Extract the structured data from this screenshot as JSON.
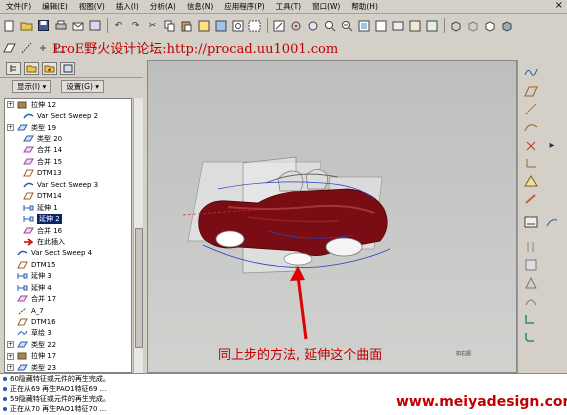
{
  "menu": {
    "items": [
      "文件(F)",
      "编辑(E)",
      "视图(V)",
      "插入(I)",
      "分析(A)",
      "信息(N)",
      "应用程序(P)",
      "工具(T)",
      "窗口(W)",
      "帮助(H)"
    ],
    "close_glyph": "×"
  },
  "watermark_top": "ProE野火设计论坛:http://procad.uu1001.com",
  "watermark_bottom": "www.meiyadesign.com",
  "panel": {
    "display_button": "显示(I) ▾",
    "settings_button": "设置(G) ▾"
  },
  "tree": {
    "items": [
      {
        "label": "拉伸 12",
        "icon": "extrude-icon",
        "expandable": true
      },
      {
        "label": "Var Sect Sweep 2",
        "icon": "sweep-icon",
        "expandable": false
      },
      {
        "label": "类型 19",
        "icon": "type-icon",
        "expandable": true
      },
      {
        "label": "类型 20",
        "icon": "type-icon",
        "expandable": false
      },
      {
        "label": "合并 14",
        "icon": "merge-icon",
        "expandable": false
      },
      {
        "label": "合并 15",
        "icon": "merge-icon",
        "expandable": false
      },
      {
        "label": "DTM13",
        "icon": "datum-plane-icon",
        "expandable": false
      },
      {
        "label": "Var Sect Sweep 3",
        "icon": "sweep-icon",
        "expandable": false
      },
      {
        "label": "DTM14",
        "icon": "datum-plane-icon",
        "expandable": false
      },
      {
        "label": "延伸 1",
        "icon": "extend-icon",
        "expandable": false
      },
      {
        "label": "延伸 2",
        "icon": "extend-icon",
        "expandable": false,
        "selected": true
      },
      {
        "label": "合并 16",
        "icon": "merge-icon",
        "expandable": false
      },
      {
        "label": "在此插入",
        "icon": "insert-here-icon",
        "expandable": false
      },
      {
        "label": "Var Sect Sweep 4",
        "icon": "sweep-icon",
        "expandable": false
      },
      {
        "label": "DTM15",
        "icon": "datum-plane-icon",
        "expandable": false
      },
      {
        "label": "延伸 3",
        "icon": "extend-icon",
        "expandable": false
      },
      {
        "label": "延伸 4",
        "icon": "extend-icon",
        "expandable": false
      },
      {
        "label": "合并 17",
        "icon": "merge-icon",
        "expandable": false
      },
      {
        "label": "A_7",
        "icon": "axis-icon",
        "expandable": false
      },
      {
        "label": "DTM16",
        "icon": "datum-plane-icon",
        "expandable": false
      },
      {
        "label": "草绘 3",
        "icon": "sketch-icon",
        "expandable": false
      },
      {
        "label": "类型 22",
        "icon": "type-icon",
        "expandable": false
      },
      {
        "label": "拉伸 17",
        "icon": "extrude-icon",
        "expandable": false
      },
      {
        "label": "类型 23",
        "icon": "type-icon",
        "expandable": false
      }
    ]
  },
  "viewport": {
    "caption": "同上步的方法, 延伸这个曲面",
    "small_label": "如右图"
  },
  "messages": [
    "60隐藏特征或元件的再生完成。",
    "正在从69 再生PAO1特征69 ...",
    "59隐藏特征或元件的再生完成。",
    "正在从70 再生PAO1特征70 ..."
  ],
  "colors": {
    "accent_red": "#c00000",
    "selection": "#0a246a",
    "car_body": "#7a0d14"
  }
}
